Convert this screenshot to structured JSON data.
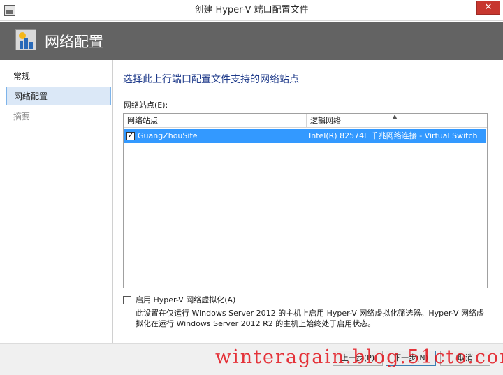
{
  "window": {
    "title": "创建 Hyper-V 端口配置文件",
    "close_label": "✕"
  },
  "banner": {
    "title": "网络配置",
    "icon": "network-config-icon"
  },
  "sidebar": {
    "items": [
      {
        "label": "常规",
        "state": "normal"
      },
      {
        "label": "网络配置",
        "state": "selected"
      },
      {
        "label": "摘要",
        "state": "disabled"
      }
    ]
  },
  "content": {
    "section_title": "选择此上行端口配置文件支持的网络站点",
    "field_label": "网络站点(E):",
    "grid": {
      "columns": [
        "网络站点",
        "逻辑网络"
      ],
      "sort_indicator": "▲",
      "rows": [
        {
          "checked": true,
          "site": "GuangZhouSite",
          "logical_network": "Intel(R) 82574L 千兆网络连接 - Virtual Switch"
        }
      ]
    },
    "virtualization_option": {
      "label": "启用 Hyper-V 网络虚拟化(A)",
      "checked": false
    },
    "description": "此设置在仅运行 Windows Server 2012 的主机上启用 Hyper-V 网络虚拟化筛选器。Hyper-V 网络虚拟化在运行 Windows Server 2012 R2 的主机上始终处于启用状态。"
  },
  "footer": {
    "back_label": "上一步(P)",
    "next_label": "下一步(N)",
    "cancel_label": "取消"
  },
  "watermark": "winteragain.blog.51cto.com",
  "colors": {
    "banner_bg": "#636363",
    "selection_blue": "#3399ff",
    "close_red": "#c7372f",
    "section_title": "#1e3a8a",
    "watermark_red": "#e3121a"
  }
}
